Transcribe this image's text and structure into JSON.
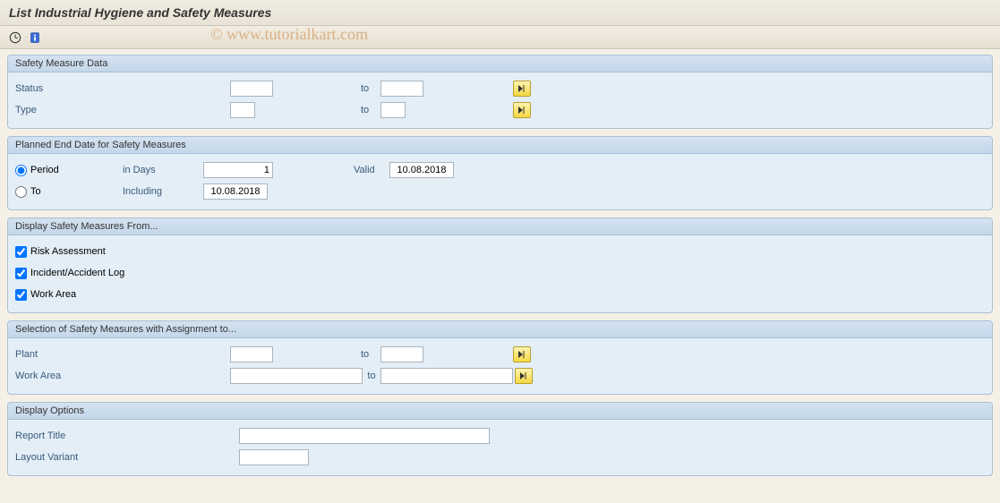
{
  "title": "List Industrial Hygiene and Safety Measures",
  "watermark": "© www.tutorialkart.com",
  "toolbar": {
    "execute": "Execute",
    "info": "Info"
  },
  "groups": {
    "safety_measure_data": {
      "title": "Safety Measure Data",
      "status_label": "Status",
      "type_label": "Type",
      "to_label": "to",
      "status_from": "",
      "status_to": "",
      "type_from": "",
      "type_to": ""
    },
    "planned_end": {
      "title": "Planned End Date for Safety Measures",
      "period_label": "Period",
      "to_label": "To",
      "in_days_label": "in Days",
      "including_label": "Including",
      "valid_label": "Valid",
      "days_value": "1",
      "valid_date": "10.08.2018",
      "including_date": "10.08.2018",
      "selected": "period"
    },
    "display_from": {
      "title": "Display Safety Measures From...",
      "risk_label": "Risk Assessment",
      "incident_label": "Incident/Accident Log",
      "workarea_label": "Work Area",
      "risk_checked": true,
      "incident_checked": true,
      "workarea_checked": true
    },
    "selection_assign": {
      "title": "Selection of Safety Measures with Assignment to...",
      "plant_label": "Plant",
      "workarea_label": "Work Area",
      "to_label": "to",
      "plant_from": "",
      "plant_to": "",
      "workarea_from": "",
      "workarea_to": ""
    },
    "display_options": {
      "title": "Display Options",
      "report_title_label": "Report Title",
      "layout_variant_label": "Layout Variant",
      "report_title": "",
      "layout_variant": ""
    }
  }
}
